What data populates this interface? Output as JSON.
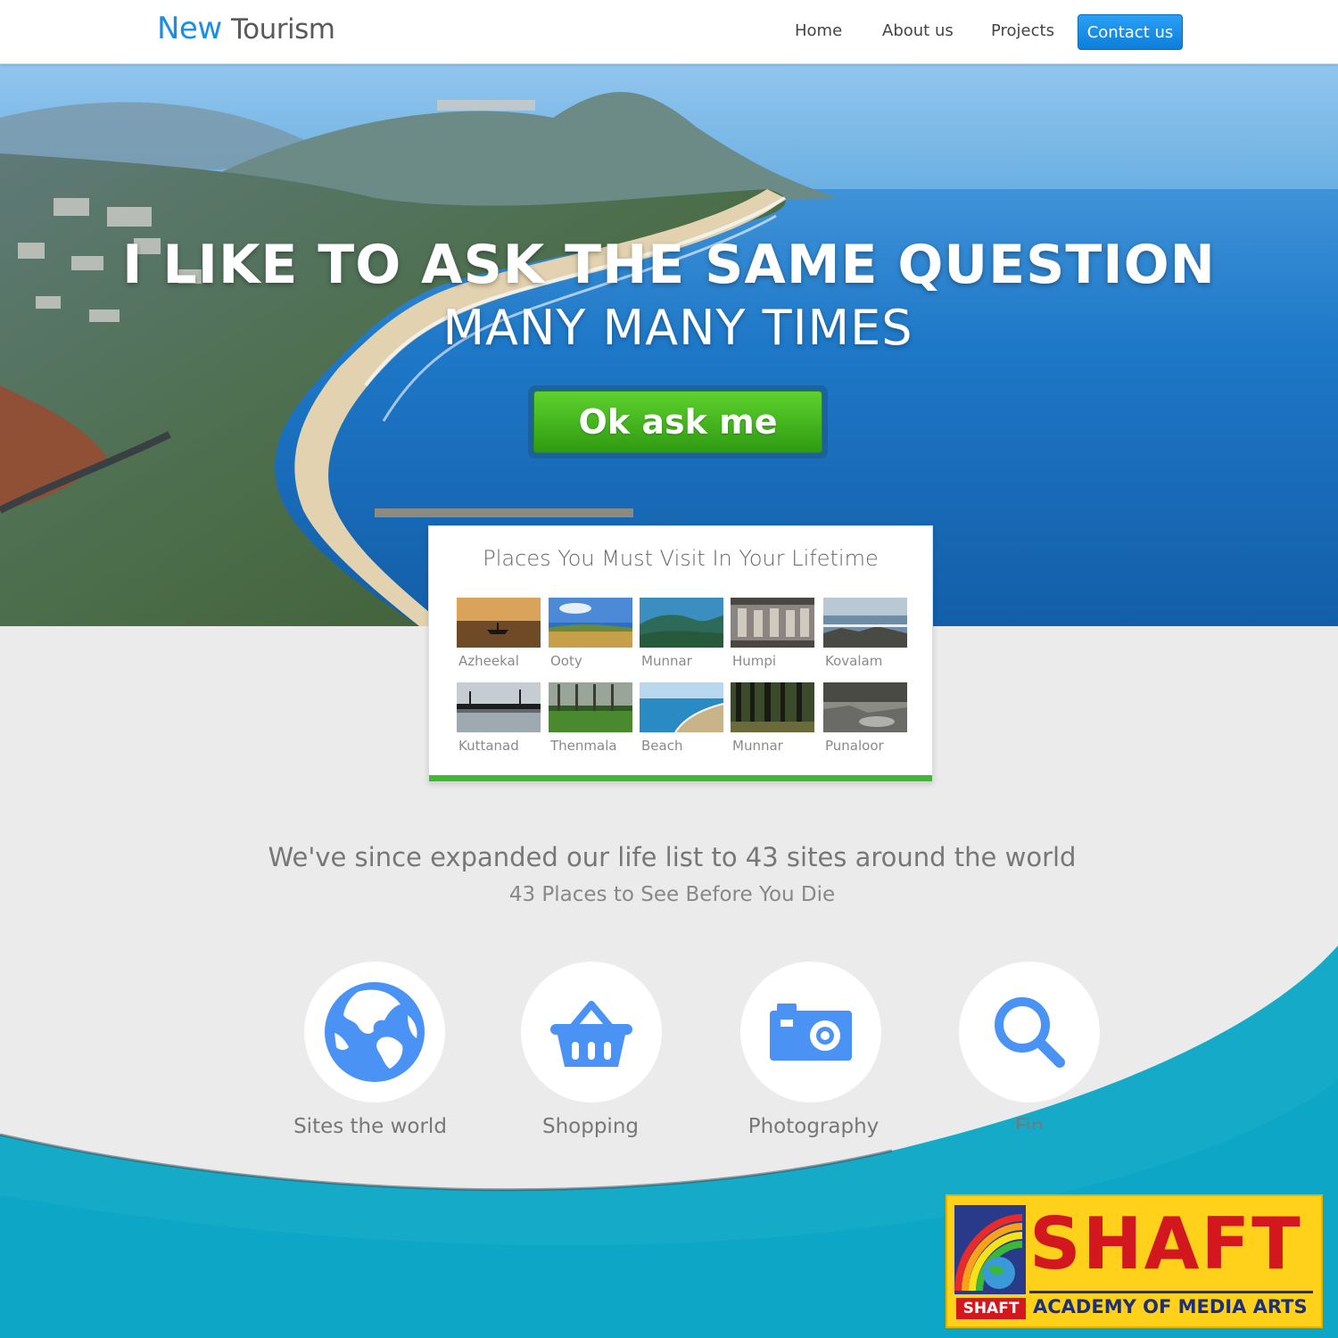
{
  "nav": {
    "brand_first": "New",
    "brand_second": "Tourism",
    "links": [
      "Home",
      "About us",
      "Projects"
    ],
    "cta": "Contact us"
  },
  "hero": {
    "title": "I LIKE TO ASK THE SAME QUESTION",
    "subtitle": "MANY MANY TIMES",
    "button": "Ok ask me"
  },
  "places": {
    "title": "Places You Must Visit In Your Lifetime",
    "items": [
      "Azheekal",
      "Ooty",
      "Munnar",
      "Humpi",
      "Kovalam",
      "Kuttanad",
      "Thenmala",
      "Beach",
      "Munnar",
      "Punaloor"
    ]
  },
  "tagline": {
    "main": "We've since expanded our life list to 43 sites around the world",
    "sub": "43 Places to See Before You Die"
  },
  "features": [
    {
      "label": "Sites the world",
      "icon": "globe-icon"
    },
    {
      "label": "Shopping",
      "icon": "basket-icon"
    },
    {
      "label": "Photography",
      "icon": "camera-icon"
    },
    {
      "label": "Fin",
      "icon": "search-icon"
    }
  ],
  "logo": {
    "name": "SHAFT",
    "subtitle": "ACADEMY OF MEDIA ARTS",
    "mini": "SHAFT"
  },
  "colors": {
    "brand_blue": "#1a8ee0",
    "cta_green": "#3fb834",
    "icon_blue": "#4a93f5",
    "wave_teal": "#14aac8"
  }
}
